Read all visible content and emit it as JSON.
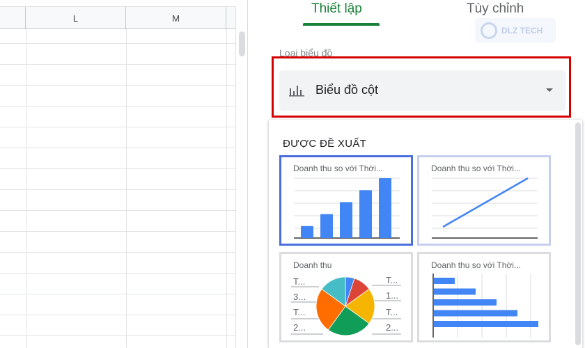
{
  "sheet": {
    "columns": [
      "",
      "L",
      "M"
    ]
  },
  "panel": {
    "tabs": [
      {
        "label": "Thiết lập",
        "active": true
      },
      {
        "label": "Tùy chỉnh",
        "active": false
      }
    ],
    "watermark": "DLZ TECH",
    "chart_type_label": "Loại biểu đồ",
    "chart_type_value": "Biểu đồ cột",
    "chart_type_icon": "bar-chart-icon",
    "suggested_title": "ĐƯỢC ĐỀ XUẤT",
    "suggestions": [
      {
        "title": "Doanh thu so với Thời...",
        "kind": "column",
        "values": [
          1,
          2,
          3,
          4,
          5
        ]
      },
      {
        "title": "Doanh thu so với Thời...",
        "kind": "line",
        "values": [
          1,
          5
        ]
      },
      {
        "title": "Doanh thu",
        "kind": "pie",
        "values": [
          5,
          10,
          20,
          25,
          25,
          15
        ],
        "labels": [
          "T...",
          "3...",
          "T...",
          "2...",
          "T...",
          "1...",
          "T...",
          "2..."
        ]
      },
      {
        "title": "Doanh thu so với Thời...",
        "kind": "horizontal-bar",
        "values": [
          1,
          2,
          3,
          4,
          5
        ]
      }
    ],
    "colors": {
      "accent": "#188038",
      "highlight": "#d50000",
      "bar": "#4285f4",
      "pie": [
        "#4285f4",
        "#db4437",
        "#f4b400",
        "#0f9d58",
        "#ff6d00",
        "#46bdc6"
      ]
    }
  }
}
